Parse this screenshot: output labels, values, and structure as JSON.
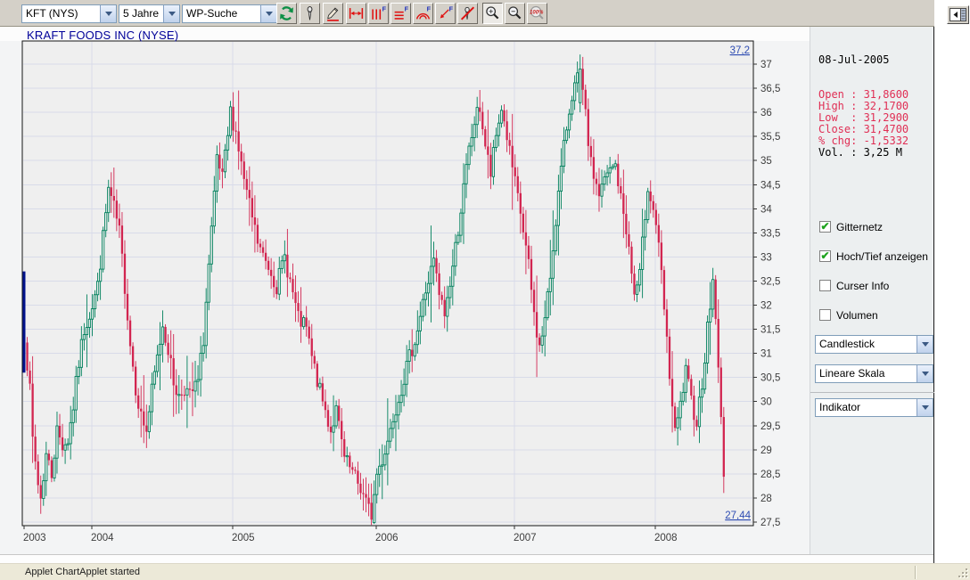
{
  "toolbar": {
    "symbol_value": "KFT (NYS)",
    "range_value": "5 Jahre",
    "search_value": "WP-Suche",
    "buttons": [
      {
        "name": "refresh",
        "pressed": false
      },
      {
        "name": "pin-marker",
        "pressed": false
      },
      {
        "name": "draw-pencil",
        "pressed": false
      },
      {
        "name": "measure",
        "pressed": false
      },
      {
        "name": "fibonacci-time-zones",
        "pressed": false
      },
      {
        "name": "fibonacci-retracement",
        "pressed": false
      },
      {
        "name": "fibonacci-arcs",
        "pressed": false
      },
      {
        "name": "fibonacci-fan",
        "pressed": false
      },
      {
        "name": "delete-drawings",
        "pressed": false
      },
      {
        "name": "zoom-in",
        "pressed": true
      },
      {
        "name": "zoom-out",
        "pressed": false
      },
      {
        "name": "zoom-100",
        "pressed": false
      }
    ],
    "collapse_button": "collapse-panel"
  },
  "chart": {
    "title": "KRAFT FOODS INC (NYSE)"
  },
  "panel": {
    "date": "08-Jul-2005",
    "quote_rows": [
      {
        "text": "Open : 31,8600",
        "red": true
      },
      {
        "text": "High : 32,1700",
        "red": true
      },
      {
        "text": "Low  : 31,2900",
        "red": true
      },
      {
        "text": "Close: 31,4700",
        "red": true
      },
      {
        "text": "% chg: -1,5332",
        "red": true
      },
      {
        "text": "Vol. : 3,25 M",
        "red": false
      }
    ],
    "checkboxes": [
      {
        "label": "Gitternetz",
        "checked": true
      },
      {
        "label": "Hoch/Tief anzeigen",
        "checked": true
      },
      {
        "label": "Curser Info",
        "checked": false
      },
      {
        "label": "Volumen",
        "checked": false
      }
    ],
    "selects": {
      "chart_type": "Candlestick",
      "scale": "Lineare Skala",
      "indicator": "Indikator"
    }
  },
  "status": {
    "text": "Applet ChartApplet started"
  },
  "chart_data": {
    "type": "candlestick",
    "title": "KRAFT FOODS INC (NYSE)",
    "timeframe": "5 Jahre",
    "interval": "weekly",
    "n_candles": 259,
    "x_ticks": [
      {
        "week": 0,
        "label": "2003"
      },
      {
        "week": 25,
        "label": "2004"
      },
      {
        "week": 77,
        "label": "2005"
      },
      {
        "week": 130,
        "label": "2006"
      },
      {
        "week": 181,
        "label": "2007"
      },
      {
        "week": 233,
        "label": "2008"
      }
    ],
    "y_axis": {
      "min": 27.5,
      "max": 37,
      "step": 0.5,
      "decimal_comma": true
    },
    "ylim": [
      27.42,
      37.48
    ],
    "grid": true,
    "high_marker": {
      "week": 205,
      "value": 37.2,
      "label": "37,2"
    },
    "low_marker": {
      "week": 128,
      "value": 27.44,
      "label": "27,44"
    },
    "first_candle": {
      "open": 32.7,
      "close": 30.6,
      "color": "#00128c"
    },
    "anchors_weekly_close": [
      [
        0,
        31.4
      ],
      [
        2,
        30.2
      ],
      [
        3,
        29.2
      ],
      [
        5,
        28.3
      ],
      [
        6,
        28.0
      ],
      [
        8,
        28.9
      ],
      [
        10,
        28.5
      ],
      [
        12,
        29.4
      ],
      [
        14,
        29.1
      ],
      [
        16,
        29.2
      ],
      [
        18,
        29.9
      ],
      [
        20,
        30.8
      ],
      [
        22,
        31.5
      ],
      [
        25,
        32.0
      ],
      [
        27,
        32.4
      ],
      [
        29,
        33.4
      ],
      [
        31,
        34.4
      ],
      [
        33,
        34.0
      ],
      [
        35,
        33.5
      ],
      [
        37,
        32.4
      ],
      [
        39,
        31.2
      ],
      [
        41,
        30.3
      ],
      [
        43,
        29.7
      ],
      [
        45,
        29.4
      ],
      [
        47,
        30.2
      ],
      [
        49,
        30.9
      ],
      [
        51,
        31.6
      ],
      [
        53,
        31.1
      ],
      [
        55,
        30.4
      ],
      [
        57,
        30.1
      ],
      [
        59,
        30.3
      ],
      [
        61,
        30.1
      ],
      [
        63,
        30.3
      ],
      [
        64,
        30.4
      ],
      [
        66,
        31.3
      ],
      [
        68,
        32.8
      ],
      [
        70,
        34.2
      ],
      [
        71,
        35.0
      ],
      [
        73,
        34.6
      ],
      [
        75,
        35.5
      ],
      [
        76,
        36.0
      ],
      [
        78,
        35.6
      ],
      [
        80,
        34.9
      ],
      [
        82,
        34.3
      ],
      [
        84,
        33.8
      ],
      [
        86,
        33.3
      ],
      [
        88,
        33.0
      ],
      [
        91,
        32.7
      ],
      [
        93,
        32.4
      ],
      [
        96,
        33.0
      ],
      [
        98,
        32.5
      ],
      [
        101,
        31.7
      ],
      [
        104,
        31.5
      ],
      [
        106,
        30.9
      ],
      [
        109,
        30.2
      ],
      [
        111,
        29.8
      ],
      [
        113,
        29.4
      ],
      [
        115,
        29.8
      ],
      [
        118,
        28.8
      ],
      [
        121,
        28.5
      ],
      [
        124,
        28.2
      ],
      [
        126,
        27.9
      ],
      [
        128,
        27.6
      ],
      [
        130,
        28.5
      ],
      [
        132,
        28.8
      ],
      [
        134,
        29.2
      ],
      [
        136,
        29.7
      ],
      [
        138,
        30.1
      ],
      [
        140,
        30.5
      ],
      [
        142,
        30.9
      ],
      [
        145,
        31.5
      ],
      [
        148,
        32.3
      ],
      [
        151,
        32.9
      ],
      [
        153,
        32.2
      ],
      [
        155,
        31.8
      ],
      [
        158,
        32.8
      ],
      [
        161,
        34.0
      ],
      [
        164,
        35.2
      ],
      [
        166,
        35.8
      ],
      [
        168,
        36.1
      ],
      [
        170,
        35.3
      ],
      [
        172,
        34.7
      ],
      [
        174,
        35.5
      ],
      [
        176,
        36.1
      ],
      [
        178,
        35.5
      ],
      [
        181,
        34.5
      ],
      [
        183,
        33.9
      ],
      [
        186,
        32.8
      ],
      [
        188,
        31.8
      ],
      [
        190,
        31.1
      ],
      [
        192,
        31.7
      ],
      [
        194,
        32.6
      ],
      [
        196,
        33.8
      ],
      [
        198,
        34.8
      ],
      [
        200,
        35.7
      ],
      [
        202,
        36.4
      ],
      [
        205,
        36.8
      ],
      [
        207,
        35.9
      ],
      [
        209,
        34.9
      ],
      [
        212,
        34.3
      ],
      [
        215,
        34.7
      ],
      [
        218,
        34.9
      ],
      [
        220,
        34.2
      ],
      [
        222,
        33.6
      ],
      [
        225,
        32.2
      ],
      [
        227,
        32.6
      ],
      [
        229,
        33.9
      ],
      [
        230,
        34.5
      ],
      [
        233,
        33.7
      ],
      [
        235,
        32.6
      ],
      [
        237,
        31.2
      ],
      [
        239,
        29.9
      ],
      [
        240,
        29.3
      ],
      [
        242,
        29.9
      ],
      [
        244,
        30.6
      ],
      [
        246,
        30.0
      ],
      [
        248,
        29.6
      ],
      [
        250,
        30.4
      ],
      [
        252,
        31.5
      ],
      [
        254,
        32.5
      ],
      [
        255,
        31.8
      ],
      [
        256,
        30.6
      ],
      [
        257,
        29.6
      ],
      [
        258,
        28.6
      ]
    ],
    "colors": {
      "up": "#00805c",
      "down": "#d22550",
      "grid": "#d8dbe9",
      "plot_bg": "#efefef",
      "selected": "#00128c",
      "marker_text": "#2e4cb2"
    }
  }
}
